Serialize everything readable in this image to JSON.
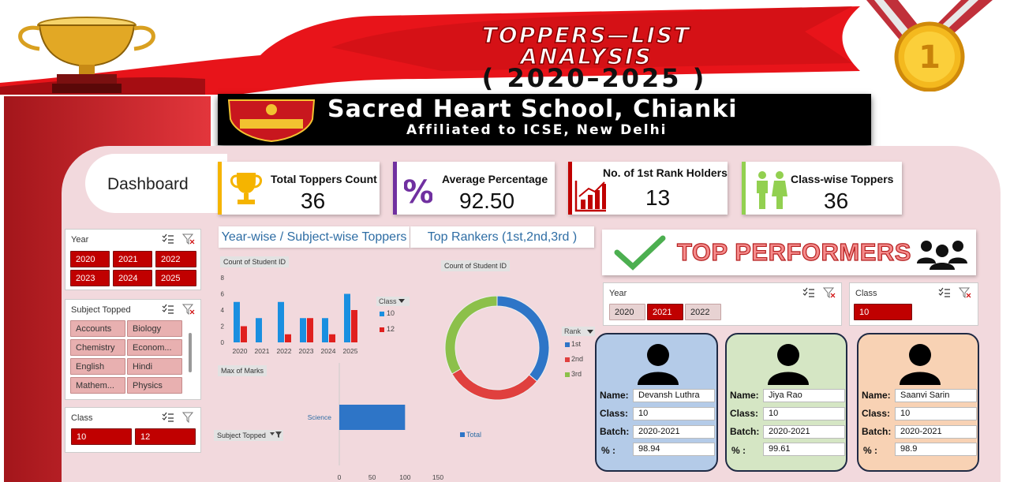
{
  "header": {
    "title_line1": "TOPPERS—LIST",
    "title_line2": "ANALYSIS",
    "title_line3": "( 2020–2025 )",
    "school_name": "Sacred Heart School, Chianki",
    "school_sub": "Affiliated to ICSE, New Delhi",
    "medal_text": "1"
  },
  "sidebar": {
    "dashboard_label": "Dashboard",
    "year_slicer": {
      "title": "Year",
      "items": [
        {
          "label": "2020",
          "selected": true
        },
        {
          "label": "2021",
          "selected": true
        },
        {
          "label": "2022",
          "selected": true
        },
        {
          "label": "2023",
          "selected": true
        },
        {
          "label": "2024",
          "selected": true
        },
        {
          "label": "2025",
          "selected": true
        }
      ]
    },
    "subject_slicer": {
      "title": "Subject Topped",
      "items": [
        {
          "label": "Accounts"
        },
        {
          "label": "Biology"
        },
        {
          "label": "Chemistry"
        },
        {
          "label": "Econom..."
        },
        {
          "label": "English"
        },
        {
          "label": "Hindi"
        },
        {
          "label": "Mathem..."
        },
        {
          "label": "Physics"
        }
      ]
    },
    "class_slicer": {
      "title": "Class",
      "items": [
        {
          "label": "10"
        },
        {
          "label": "12"
        }
      ]
    }
  },
  "kpis": [
    {
      "title": "Total Toppers Count",
      "value": "36",
      "color": "#f5b400",
      "icon": "trophy-icon"
    },
    {
      "title": "Average Percentage",
      "value": "92.50",
      "color": "#7030a0",
      "icon": "percent-icon"
    },
    {
      "title": "No. of 1st Rank Holders",
      "value": "13",
      "color": "#c00000",
      "icon": "bar-chart-icon"
    },
    {
      "title": "Class-wise Toppers",
      "value": "36",
      "color": "#92d050",
      "icon": "people-icon"
    }
  ],
  "sections": {
    "yearwise_title": "Year-wise / Subject-wise Toppers",
    "rankers_title": "Top Rankers (1st,2nd,3rd )",
    "top_performers": "TOP PERFORMERS"
  },
  "bar_chart": {
    "field_tag": "Count of Student ID",
    "legend_title": "Class",
    "y_ticks": [
      "8",
      "6",
      "4",
      "2",
      "0"
    ],
    "chart_data": {
      "type": "bar",
      "categories": [
        "2020",
        "2021",
        "2022",
        "2023",
        "2024",
        "2025"
      ],
      "series": [
        {
          "name": "10",
          "values": [
            5,
            3,
            5,
            3,
            3,
            6
          ],
          "color": "#1a8fe0"
        },
        {
          "name": "12",
          "values": [
            2,
            0,
            1,
            3,
            1,
            4
          ],
          "color": "#e0201e"
        }
      ],
      "ylim": [
        0,
        8
      ]
    }
  },
  "marks_chart": {
    "field_tag": "Max of Marks",
    "filter_tag": "Subject Topped",
    "legend_label": "Total",
    "x_ticks": [
      "0",
      "50",
      "100",
      "150"
    ],
    "chart_data": {
      "type": "bar",
      "categories": [
        "Science"
      ],
      "values": [
        100
      ],
      "xlim": [
        0,
        150
      ]
    }
  },
  "donut_chart": {
    "field_tag": "Count of Student ID",
    "legend_title": "Rank",
    "chart_data": {
      "type": "pie",
      "categories": [
        "1st",
        "2nd",
        "3rd"
      ],
      "values": [
        13,
        11,
        12
      ],
      "colors": [
        "#2e75c7",
        "#e0403e",
        "#8cc04a"
      ]
    }
  },
  "performer_filters": {
    "year_title": "Year",
    "years": [
      {
        "label": "2020",
        "selected": false
      },
      {
        "label": "2021",
        "selected": true
      },
      {
        "label": "2022",
        "selected": false
      }
    ],
    "class_title": "Class",
    "class_value": "10"
  },
  "labels": {
    "name": "Name:",
    "class": "Class:",
    "batch": "Batch:",
    "percent": "% :"
  },
  "performers": [
    {
      "name": "Devansh Luthra",
      "class": "10",
      "batch": "2020-2021",
      "percent": "98.94",
      "bg": "#b4cbe8"
    },
    {
      "name": "Jiya Rao",
      "class": "10",
      "batch": "2020-2021",
      "percent": "99.61",
      "bg": "#d5e6c4"
    },
    {
      "name": "Saanvi Sarin",
      "class": "10",
      "batch": "2020-2021",
      "percent": "98.9",
      "bg": "#f8d2b4"
    }
  ]
}
